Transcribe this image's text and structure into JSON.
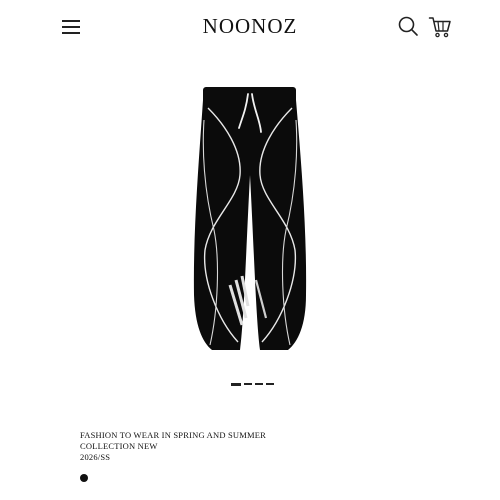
{
  "header": {
    "brand": "NOONOZ",
    "menu_icon": "hamburger-menu-icon",
    "search_icon": "search-icon",
    "cart_icon": "shopping-cart-icon"
  },
  "product": {
    "image_subject": "black wide-leg track pants",
    "description_lines": [
      "FASHION TO WEAR IN SPRING AND SUMMER",
      "COLLECTION NEW",
      "2026/SS"
    ],
    "swatches": [
      {
        "color": "#111111"
      }
    ]
  },
  "gallery": {
    "page_count": 4,
    "active_index": 0
  }
}
